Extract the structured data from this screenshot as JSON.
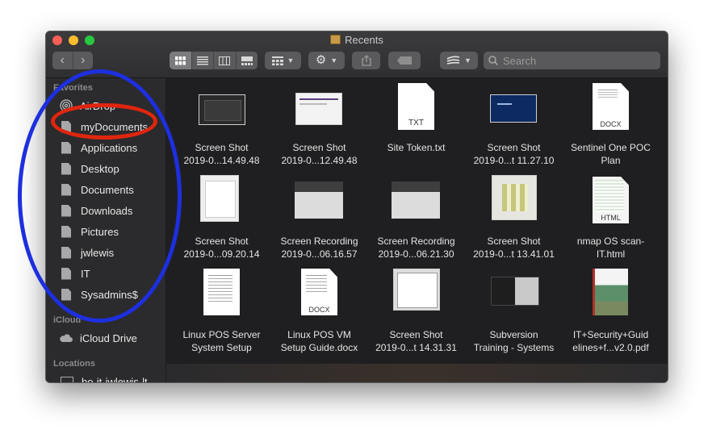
{
  "window": {
    "title": "Recents"
  },
  "search": {
    "placeholder": "Search"
  },
  "sidebar": {
    "favorites_header": "Favorites",
    "favorites": [
      {
        "label": "AirDrop",
        "icon": "airdrop-icon"
      },
      {
        "label": "myDocuments",
        "icon": "folder-icon"
      },
      {
        "label": "Applications",
        "icon": "folder-icon"
      },
      {
        "label": "Desktop",
        "icon": "folder-icon"
      },
      {
        "label": "Documents",
        "icon": "folder-icon"
      },
      {
        "label": "Downloads",
        "icon": "folder-icon"
      },
      {
        "label": "Pictures",
        "icon": "folder-icon"
      },
      {
        "label": "jwlewis",
        "icon": "folder-icon"
      },
      {
        "label": "IT",
        "icon": "folder-icon"
      },
      {
        "label": "Sysadmins$",
        "icon": "folder-icon"
      }
    ],
    "icloud_header": "iCloud",
    "icloud": [
      {
        "label": "iCloud Drive",
        "icon": "cloud-icon"
      }
    ],
    "locations_header": "Locations",
    "locations": [
      {
        "label": "bo-it-jwlewis-lt",
        "icon": "computer-icon"
      }
    ]
  },
  "files": [
    {
      "line1": "Screen Shot",
      "line2": "2019-0...14.49.48",
      "kind": "screenshot-dark"
    },
    {
      "line1": "Screen Shot",
      "line2": "2019-0...12.49.48",
      "kind": "screenshot-light"
    },
    {
      "line1": "Site Token.txt",
      "line2": "",
      "kind": "doc",
      "ext": "TXT"
    },
    {
      "line1": "Screen Shot",
      "line2": "2019-0...t 11.27.10",
      "kind": "screenshot-blue"
    },
    {
      "line1": "Sentinel One POC",
      "line2": "Plan",
      "kind": "doc",
      "ext": "DOCX"
    },
    {
      "line1": "Screen Shot",
      "line2": "2019-0...09.20.14",
      "kind": "screenshot-dialog"
    },
    {
      "line1": "Screen Recording",
      "line2": "2019-0...06.16.57",
      "kind": "recording"
    },
    {
      "line1": "Screen Recording",
      "line2": "2019-0...06.21.30",
      "kind": "recording"
    },
    {
      "line1": "Screen Shot",
      "line2": "2019-0...t 13.41.01",
      "kind": "screenshot-pattern"
    },
    {
      "line1": "nmap OS scan-",
      "line2": "IT.html",
      "kind": "doc",
      "ext": "HTML"
    },
    {
      "line1": "Linux POS Server",
      "line2": "System Setup",
      "kind": "doc",
      "ext": ""
    },
    {
      "line1": "Linux POS VM",
      "line2": "Setup Guide.docx",
      "kind": "doc",
      "ext": "DOCX"
    },
    {
      "line1": "Screen Shot",
      "line2": "2019-0...t 14.31.31",
      "kind": "screenshot-window"
    },
    {
      "line1": "Subversion",
      "line2": "Training - Systems",
      "kind": "slide"
    },
    {
      "line1": "IT+Security+Guid",
      "line2": "elines+f...v2.0.pdf",
      "kind": "pdf"
    }
  ],
  "colors": {
    "annotation_red": "#e0250e",
    "annotation_blue": "#1d2fde"
  }
}
